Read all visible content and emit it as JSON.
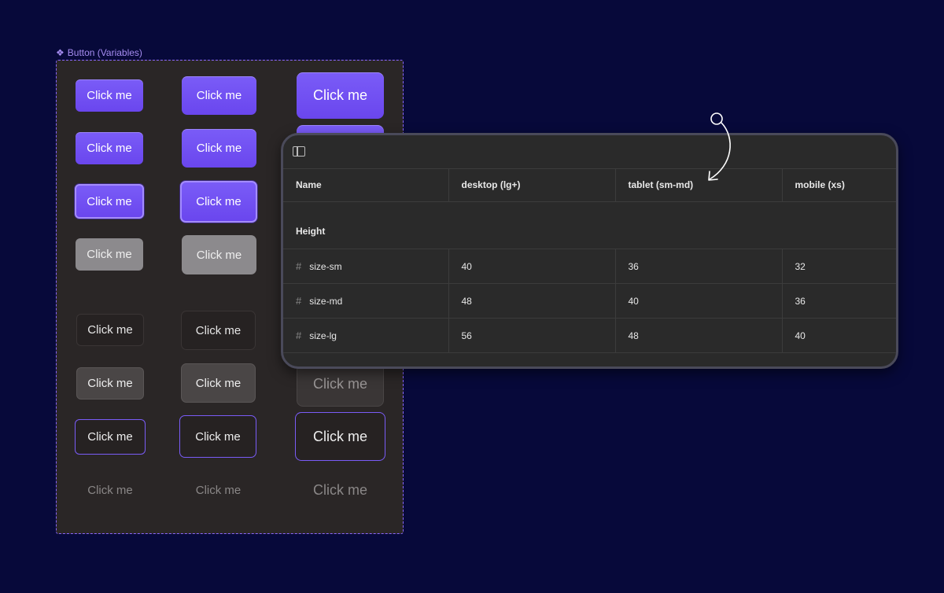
{
  "frame": {
    "label": "Button (Variables)",
    "icon": "component-diamond-icon"
  },
  "buttons": {
    "label": "Click me"
  },
  "panel": {
    "toolbar_icon": "sidebar-toggle-icon",
    "columns": [
      "Name",
      "desktop (lg+)",
      "tablet (sm-md)",
      "mobile (xs)"
    ],
    "group": "Height",
    "rows": [
      {
        "name": "size-sm",
        "values": [
          "40",
          "36",
          "32"
        ]
      },
      {
        "name": "size-md",
        "values": [
          "48",
          "40",
          "36"
        ]
      },
      {
        "name": "size-lg",
        "values": [
          "56",
          "48",
          "40"
        ]
      }
    ]
  },
  "colors": {
    "background": "#07093a",
    "accent": "#7a5cf7",
    "frame_border": "#8a66ff",
    "panel_bg": "#2a2a2a"
  }
}
